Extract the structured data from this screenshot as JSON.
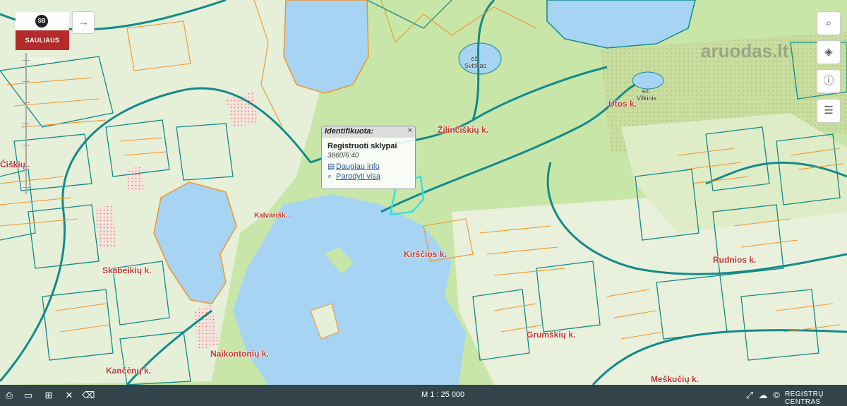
{
  "colors": {
    "forest": "#c9e6a9",
    "field": "#eef3e6",
    "water": "#a6d4f2",
    "parcel_teal": "#138a8a",
    "parcel_orange": "#f0952a",
    "selected": "#37e0e0",
    "toolbar_bg": "#1e2d3c"
  },
  "logo": {
    "mark": "SB",
    "text": "SAULIAUS BŪSTAS"
  },
  "share_icon": "→",
  "watermark": "aruodas.lt",
  "right_tools": [
    {
      "name": "search-icon",
      "glyph": "⌕"
    },
    {
      "name": "layers-icon",
      "glyph": "◈"
    },
    {
      "name": "info-icon",
      "glyph": "ⓘ"
    },
    {
      "name": "document-icon",
      "glyph": "☰"
    }
  ],
  "place_labels": {
    "zilinciskiu": "Žilinčiškių k.",
    "utos": "Ūtos k.",
    "rudnios": "Rudnios k.",
    "grumskiu": "Grumškių k.",
    "kalvariski": "Kalvarišk…",
    "skabeikiu": "Skabeikių k.",
    "kancenu": "Kančėnų k.",
    "naikontonu": "Naikontonių k.",
    "meskuciu": "Meškučių k.",
    "ciskiu": "Čiškių",
    "kirscios": "Kirščios k."
  },
  "lake_labels": {
    "svitikas": {
      "line1": "ež.",
      "line2": "Svitikas"
    },
    "vilkinis": {
      "line1": "ež.",
      "line2": "Vilkinis"
    }
  },
  "popup": {
    "header": "Identifikuota:",
    "close": "×",
    "title": "Registruoti sklypai",
    "parcel_id": "3860/6:40",
    "link_more": "Daugiau info",
    "link_show": "Parodyti visą"
  },
  "bottom": {
    "tools": [
      {
        "name": "print-icon",
        "glyph": "⎙"
      },
      {
        "name": "measure-icon",
        "glyph": "▭"
      },
      {
        "name": "add-layer-icon",
        "glyph": "⊞"
      },
      {
        "name": "coordinates-icon",
        "glyph": "✕"
      },
      {
        "name": "eraser-icon",
        "glyph": "⌫"
      }
    ],
    "scale": "M 1 : 25 000",
    "fullscreen_icon": "⤢",
    "cloud_icon": "☁",
    "copyright_icon": "©",
    "credit": "REGISTRŲ CENTRAS"
  }
}
